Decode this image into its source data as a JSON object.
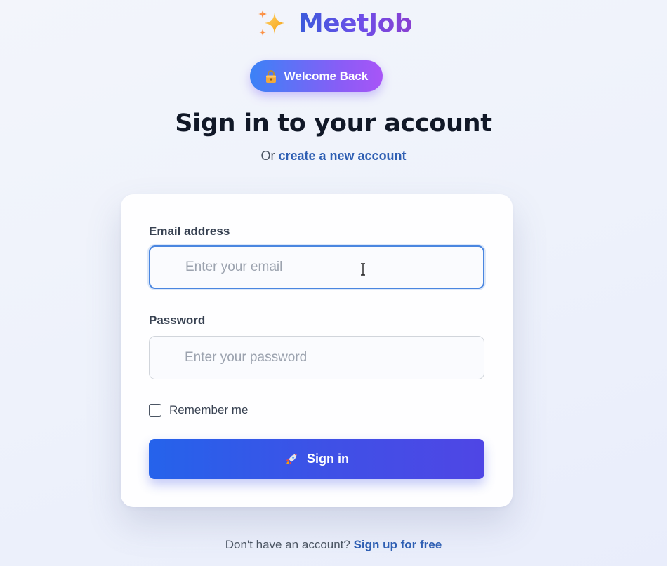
{
  "brand": {
    "name": "MeetJob",
    "icon": "sparkles-icon"
  },
  "welcome_badge": {
    "label": "Welcome Back",
    "icon": "lock-icon"
  },
  "heading": {
    "title": "Sign in to your account",
    "prefix": "Or",
    "create_link": "create a new account"
  },
  "form": {
    "email": {
      "label": "Email address",
      "placeholder": "Enter your email",
      "value": ""
    },
    "password": {
      "label": "Password",
      "placeholder": "Enter your password",
      "value": ""
    },
    "remember": {
      "label": "Remember me",
      "checked": false
    },
    "submit": {
      "label": "Sign in",
      "icon": "rocket-icon"
    }
  },
  "footer": {
    "text": "Don't have an account?",
    "link": "Sign up for free"
  },
  "colors": {
    "brand_gradient_start": "#3b5bdb",
    "brand_gradient_end": "#8a3fd1",
    "link": "#2f5fb3",
    "button_start": "#2563eb",
    "button_end": "#4f46e5",
    "focus_border": "#4a86e0"
  }
}
